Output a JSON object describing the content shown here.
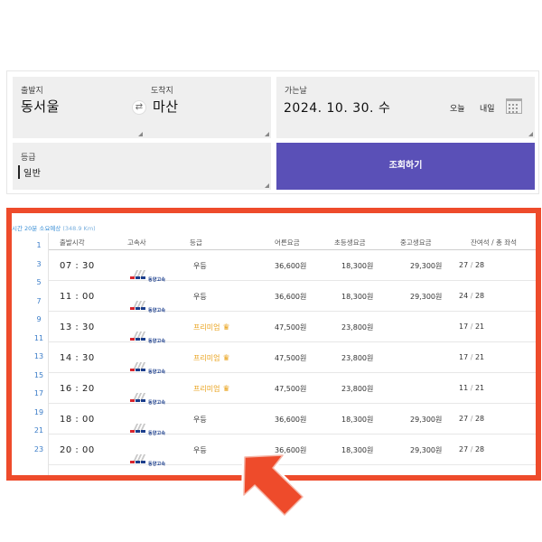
{
  "search": {
    "departure": {
      "label": "출발지",
      "value": "동서울"
    },
    "arrival": {
      "label": "도착지",
      "value": "마산"
    },
    "date": {
      "label": "가는날",
      "value": "2024. 10. 30. 수",
      "today_label": "오늘",
      "tomorrow_label": "내일"
    },
    "grade": {
      "label": "등급",
      "value": "일반"
    },
    "search_button": "조회하기",
    "swap_symbol": "⇄"
  },
  "results": {
    "summary": "시간 20분 소요예상",
    "distance": "(348.9 Km)",
    "hours": [
      "1",
      "3",
      "5",
      "7",
      "9",
      "11",
      "13",
      "15",
      "17",
      "19",
      "21",
      "23"
    ],
    "columns": {
      "time": "출발시각",
      "company": "고속사",
      "grade": "등급",
      "adult": "어른요금",
      "child": "초등생요금",
      "teen": "중고생요금",
      "seats": "잔여석 / 총 좌석"
    },
    "rows": [
      {
        "time": "07 : 30",
        "company": "동양고속",
        "grade": "우등",
        "premium": false,
        "adult": "36,600원",
        "child": "18,300원",
        "teen": "29,300원",
        "seats_left": "27",
        "seats_total": "28"
      },
      {
        "time": "11 : 00",
        "company": "동양고속",
        "grade": "우등",
        "premium": false,
        "adult": "36,600원",
        "child": "18,300원",
        "teen": "29,300원",
        "seats_left": "24",
        "seats_total": "28"
      },
      {
        "time": "13 : 30",
        "company": "동양고속",
        "grade": "프리미엄",
        "premium": true,
        "adult": "47,500원",
        "child": "23,800원",
        "teen": "",
        "seats_left": "17",
        "seats_total": "21"
      },
      {
        "time": "14 : 30",
        "company": "동양고속",
        "grade": "프리미엄",
        "premium": true,
        "adult": "47,500원",
        "child": "23,800원",
        "teen": "",
        "seats_left": "17",
        "seats_total": "21"
      },
      {
        "time": "16 : 20",
        "company": "동양고속",
        "grade": "프리미엄",
        "premium": true,
        "adult": "47,500원",
        "child": "23,800원",
        "teen": "",
        "seats_left": "11",
        "seats_total": "21"
      },
      {
        "time": "18 : 00",
        "company": "동양고속",
        "grade": "우등",
        "premium": false,
        "adult": "36,600원",
        "child": "18,300원",
        "teen": "29,300원",
        "seats_left": "27",
        "seats_total": "28"
      },
      {
        "time": "20 : 00",
        "company": "동양고속",
        "grade": "우등",
        "premium": false,
        "adult": "36,600원",
        "child": "18,300원",
        "teen": "29,300원",
        "seats_left": "27",
        "seats_total": "28"
      }
    ]
  },
  "colors": {
    "accent": "#5a50b7",
    "highlight": "#ee4b2b",
    "premium": "#e9a21b",
    "hour_link": "#3a7cc8"
  },
  "icons": {
    "swap": "swap-arrows-icon",
    "calendar": "calendar-icon",
    "crown": "crown-icon",
    "pointer": "pointer-arrow-icon"
  }
}
